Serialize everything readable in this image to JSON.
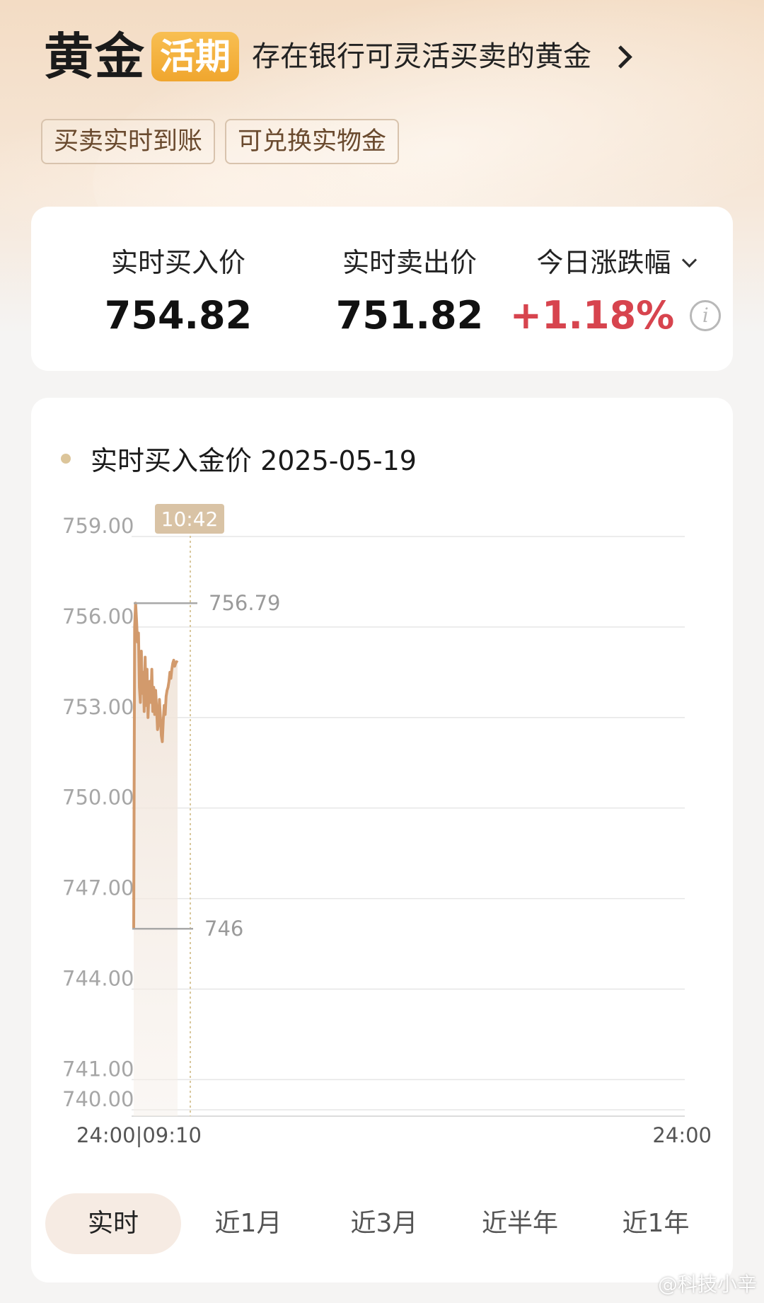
{
  "header": {
    "brand": "黄金",
    "badge": "活期",
    "subtitle": "存在银行可灵活买卖的黄金"
  },
  "tags": [
    "买卖实时到账",
    "可兑换实物金"
  ],
  "prices": {
    "buy_label": "实时买入价",
    "buy_value": "754.82",
    "sell_label": "实时卖出价",
    "sell_value": "751.82",
    "change_label": "今日涨跌幅",
    "change_value": "+1.18%",
    "change_color": "#d7444e"
  },
  "chart_title": "实时买入金价 2025-05-19",
  "chart_data": {
    "type": "line",
    "y_ticks": [
      "759.00",
      "756.00",
      "753.00",
      "750.00",
      "747.00",
      "744.00",
      "741.00",
      "740.00"
    ],
    "ylim": [
      740,
      759
    ],
    "x_labels": [
      "24:00|09:10",
      "24:00"
    ],
    "cursor_time": "10:42",
    "high_label": "756.79",
    "low_label": "746",
    "series": [
      {
        "color": "#d29a6c",
        "x": [
          "09:10",
          "09:12",
          "09:14",
          "09:16",
          "09:18",
          "09:20",
          "09:22",
          "09:24",
          "09:26",
          "09:28",
          "09:30",
          "09:32",
          "09:34",
          "09:36",
          "09:38",
          "09:40",
          "09:42",
          "09:44",
          "09:46",
          "09:48",
          "09:50",
          "09:52",
          "09:54",
          "09:56",
          "09:58",
          "10:00",
          "10:02",
          "10:04",
          "10:06",
          "10:08",
          "10:10",
          "10:12",
          "10:14",
          "10:16",
          "10:18",
          "10:20",
          "10:22",
          "10:24",
          "10:26",
          "10:28",
          "10:30",
          "10:32",
          "10:34",
          "10:36",
          "10:38",
          "10:40",
          "10:42"
        ],
        "values": [
          746.0,
          756.0,
          756.79,
          756.2,
          755.5,
          755.8,
          754.0,
          753.5,
          755.2,
          753.8,
          754.5,
          753.2,
          755.0,
          753.4,
          754.6,
          753.0,
          753.8,
          754.2,
          753.5,
          754.6,
          753.2,
          754.0,
          753.1,
          753.9,
          753.3,
          752.6,
          752.8,
          753.6,
          753.0,
          752.4,
          752.2,
          752.9,
          753.4,
          753.1,
          753.7,
          753.9,
          754.0,
          754.2,
          754.5,
          754.3,
          754.6,
          754.8,
          754.9,
          754.7,
          754.8,
          754.85,
          754.82
        ]
      }
    ],
    "grid": true
  },
  "tabs": [
    "实时",
    "近1月",
    "近3月",
    "近半年",
    "近1年"
  ],
  "active_tab": 0,
  "watermark": "@科技小辛"
}
